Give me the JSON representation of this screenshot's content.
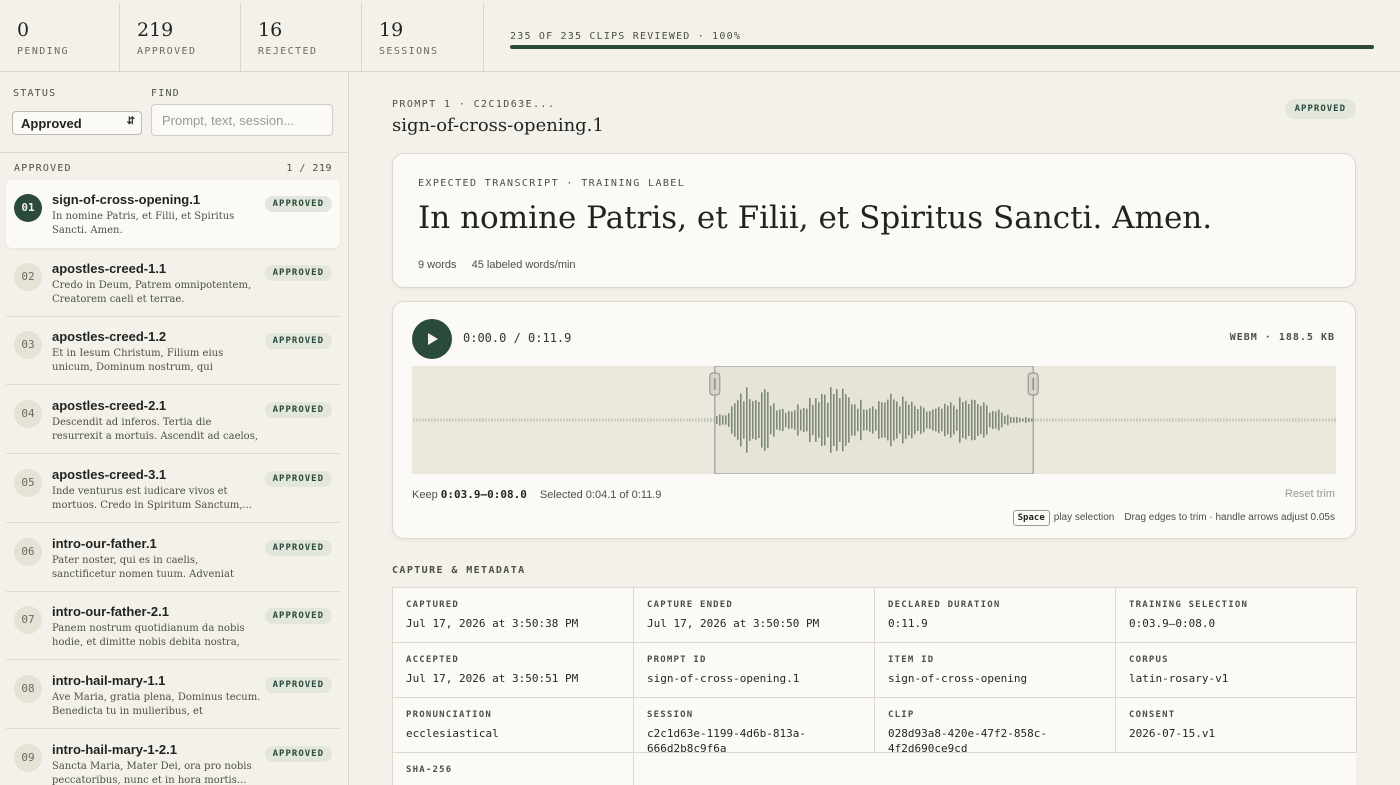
{
  "stats": [
    {
      "value": "0",
      "label": "PENDING"
    },
    {
      "value": "219",
      "label": "APPROVED"
    },
    {
      "value": "16",
      "label": "REJECTED"
    },
    {
      "value": "19",
      "label": "SESSIONS"
    }
  ],
  "progress": {
    "label": "235 OF 235 CLIPS REVIEWED · 100%",
    "fraction": 1.0
  },
  "filters": {
    "status_label": "STATUS",
    "status_value": "Approved",
    "find_label": "FIND",
    "find_placeholder": "Prompt, text, session..."
  },
  "list": {
    "heading": "APPROVED",
    "count": "1 / 219",
    "items": [
      {
        "num": "01",
        "title": "sign-of-cross-opening.1",
        "text": "In nomine Patris, et Filii, et Spiritus Sancti. Amen.",
        "status": "APPROVED"
      },
      {
        "num": "02",
        "title": "apostles-creed-1.1",
        "text": "Credo in Deum, Patrem omnipotentem, Creatorem caeli et terrae.",
        "status": "APPROVED"
      },
      {
        "num": "03",
        "title": "apostles-creed-1.2",
        "text": "Et in Iesum Christum, Filium eius unicum, Dominum nostrum, qui conceptus est de...",
        "status": "APPROVED"
      },
      {
        "num": "04",
        "title": "apostles-creed-2.1",
        "text": "Descendit ad inferos. Tertia die resurrexit a mortuis. Ascendit ad caelos, sedet ad...",
        "status": "APPROVED"
      },
      {
        "num": "05",
        "title": "apostles-creed-3.1",
        "text": "Inde venturus est iudicare vivos et mortuos. Credo in Spiritum Sanctum,...",
        "status": "APPROVED"
      },
      {
        "num": "06",
        "title": "intro-our-father.1",
        "text": "Pater noster, qui es in caelis, sanctificetur nomen tuum. Adveniat regnum tuum. Fi...",
        "status": "APPROVED"
      },
      {
        "num": "07",
        "title": "intro-our-father-2.1",
        "text": "Panem nostrum quotidianum da nobis hodie, et dimitte nobis debita nostra, sic...",
        "status": "APPROVED"
      },
      {
        "num": "08",
        "title": "intro-hail-mary-1.1",
        "text": "Ave Maria, gratia plena, Dominus tecum. Benedicta tu in mulieribus, et benedictus...",
        "status": "APPROVED"
      },
      {
        "num": "09",
        "title": "intro-hail-mary-1-2.1",
        "text": "Sancta Maria, Mater Dei, ora pro nobis peccatoribus, nunc et in hora mortis...",
        "status": "APPROVED"
      }
    ]
  },
  "detail": {
    "crumb": "PROMPT 1 · C2C1D63E...",
    "title": "sign-of-cross-opening.1",
    "status": "APPROVED",
    "transcript_kicker": "EXPECTED TRANSCRIPT · TRAINING LABEL",
    "transcript": "In nomine Patris, et Filii, et Spiritus Sancti. Amen.",
    "words": "9 words",
    "rate": "45 labeled words/min",
    "player": {
      "timecode": "0:00.0 / 0:11.9",
      "file_info": "WEBM · 188.5 KB",
      "keep_prefix": "Keep",
      "keep_range": "0:03.9–0:08.0",
      "selected": "Selected 0:04.1 of 0:11.9",
      "reset": "Reset trim",
      "key": "Space",
      "key_hint": "play selection",
      "drag_hint": "Drag edges to trim · handle arrows adjust 0.05s",
      "duration_s": 11.9,
      "trim_start_s": 3.9,
      "trim_end_s": 8.0
    },
    "metadata_heading": "CAPTURE & METADATA",
    "metadata": [
      {
        "key": "CAPTURED",
        "value": "Jul 17, 2026 at 3:50:38 PM"
      },
      {
        "key": "CAPTURE ENDED",
        "value": "Jul 17, 2026 at 3:50:50 PM"
      },
      {
        "key": "DECLARED DURATION",
        "value": "0:11.9"
      },
      {
        "key": "TRAINING SELECTION",
        "value": "0:03.9–0:08.0"
      },
      {
        "key": "ACCEPTED",
        "value": "Jul 17, 2026 at 3:50:51 PM"
      },
      {
        "key": "PROMPT ID",
        "value": "sign-of-cross-opening.1"
      },
      {
        "key": "ITEM ID",
        "value": "sign-of-cross-opening"
      },
      {
        "key": "CORPUS",
        "value": "latin-rosary-v1"
      },
      {
        "key": "PRONUNCIATION",
        "value": "ecclesiastical"
      },
      {
        "key": "SESSION",
        "value": "c2c1d63e-1199-4d6b-813a-666d2b8c9f6a"
      },
      {
        "key": "CLIP",
        "value": "028d93a8-420e-47f2-858c-4f2d690ce9cd"
      },
      {
        "key": "CONSENT",
        "value": "2026-07-15.v1"
      },
      {
        "key": "SHA-256",
        "value": ""
      }
    ]
  },
  "colors": {
    "accent": "#2a4a3a",
    "wave": "#9aa394",
    "selection": "#e6e3d8"
  }
}
